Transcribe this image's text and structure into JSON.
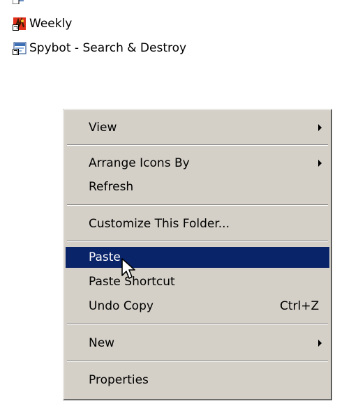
{
  "desktop": {
    "shortcuts": [
      {
        "label": "Weekly",
        "icon": "weekly-app-icon"
      },
      {
        "label": "Spybot - Search & Destroy",
        "icon": "spybot-app-icon"
      }
    ]
  },
  "context_menu": {
    "items": {
      "view": {
        "label": "View",
        "submenu": true
      },
      "arrange": {
        "label": "Arrange Icons By",
        "submenu": true
      },
      "refresh": {
        "label": "Refresh"
      },
      "customize": {
        "label": "Customize This Folder..."
      },
      "paste": {
        "label": "Paste",
        "highlighted": true
      },
      "paste_shortcut": {
        "label": "Paste Shortcut"
      },
      "undo_copy": {
        "label": "Undo Copy",
        "shortcut": "Ctrl+Z"
      },
      "new": {
        "label": "New",
        "submenu": true
      },
      "properties": {
        "label": "Properties"
      }
    }
  },
  "colors": {
    "menu_bg": "#d4d0c8",
    "highlight": "#0a246a",
    "highlight_text": "#ffffff"
  }
}
